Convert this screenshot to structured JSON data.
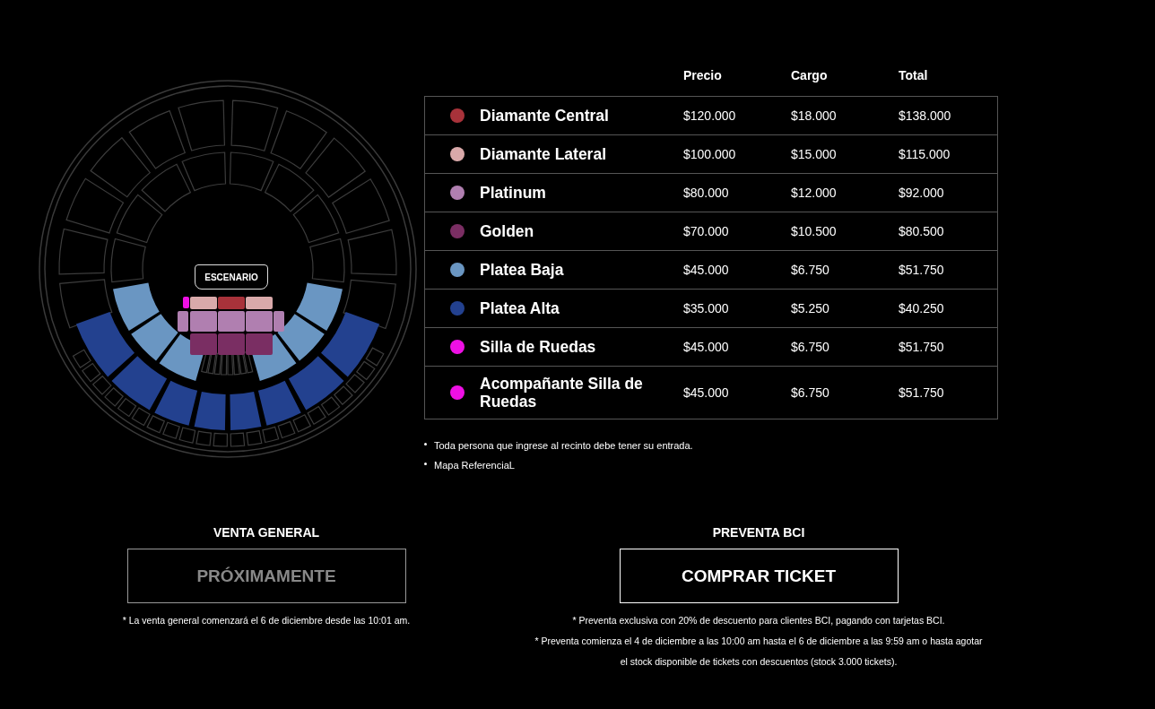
{
  "map": {
    "stage_label": "ESCENARIO"
  },
  "table": {
    "columns": [
      "Precio",
      "Cargo",
      "Total"
    ],
    "rows": [
      {
        "name": "Diamante Central",
        "color": "#a8323a",
        "price": "$120.000",
        "fee": "$18.000",
        "total": "$138.000"
      },
      {
        "name": "Diamante Lateral",
        "color": "#d9a9aa",
        "price": "$100.000",
        "fee": "$15.000",
        "total": "$115.000"
      },
      {
        "name": "Platinum",
        "color": "#b07fb0",
        "price": "$80.000",
        "fee": "$12.000",
        "total": "$92.000"
      },
      {
        "name": "Golden",
        "color": "#7a2e63",
        "price": "$70.000",
        "fee": "$10.500",
        "total": "$80.500"
      },
      {
        "name": "Platea Baja",
        "color": "#6a96c2",
        "price": "$45.000",
        "fee": "$6.750",
        "total": "$51.750"
      },
      {
        "name": "Platea Alta",
        "color": "#23418f",
        "price": "$35.000",
        "fee": "$5.250",
        "total": "$40.250"
      },
      {
        "name": "Silla de Ruedas",
        "color": "#ee10e4",
        "price": "$45.000",
        "fee": "$6.750",
        "total": "$51.750"
      },
      {
        "name": "Acompañante Silla de Ruedas",
        "color": "#ee10e4",
        "price": "$45.000",
        "fee": "$6.750",
        "total": "$51.750"
      }
    ]
  },
  "notes": [
    "Toda persona que ingrese al recinto debe tener su entrada.",
    "Mapa ReferenciaL"
  ],
  "sales": [
    {
      "title": "VENTA GENERAL",
      "button": "PRÓXIMAMENTE",
      "disabled": true,
      "notes": [
        "* La venta general comenzará el 6 de diciembre desde las 10:01 am."
      ]
    },
    {
      "title": "PREVENTA BCI",
      "button": "COMPRAR TICKET",
      "disabled": false,
      "notes": [
        "* Preventa exclusiva con 20% de descuento para clientes BCI, pagando con tarjetas BCI.",
        "* Preventa comienza el 4 de diciembre a las 10:00 am hasta el 6 de diciembre a las 9:59 am o hasta agotar el stock disponible de tickets con descuentos (stock 3.000 tickets)."
      ]
    }
  ]
}
